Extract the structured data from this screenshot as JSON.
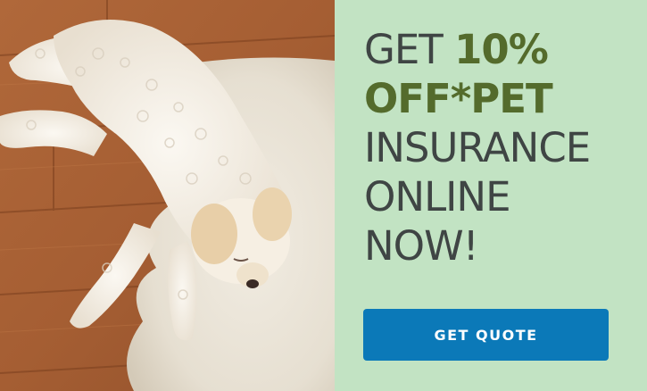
{
  "ad": {
    "headline": {
      "line1_plain": "GET ",
      "line1_accent": "10%",
      "line2_accent": "OFF*PET",
      "line3": "INSURANCE",
      "line4": "ONLINE",
      "line5": "NOW!"
    },
    "cta_label": "GET QUOTE"
  },
  "colors": {
    "panel_background": "#c2e3c3",
    "headline_text": "#3f4544",
    "headline_accent": "#546b2c",
    "cta_background": "#0b79b8",
    "cta_text": "#ffffff"
  },
  "image": {
    "subject": "dog-lying-on-rug"
  }
}
